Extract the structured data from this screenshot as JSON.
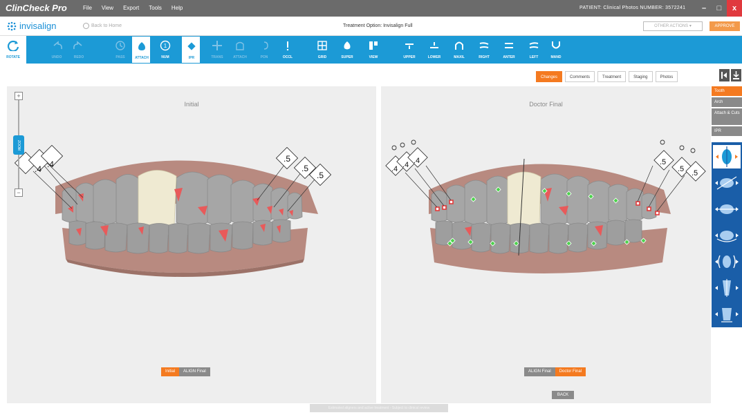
{
  "app": {
    "brand": "ClinCheck Pro",
    "menu": [
      "File",
      "View",
      "Export",
      "Tools",
      "Help"
    ],
    "patient_info": "PATIENT:  Clinical Photos  NUMBER:  3572241",
    "win_min": "–",
    "win_max": "□",
    "win_close": "x"
  },
  "header": {
    "logo": "invisalign",
    "back_home": "Back to Home",
    "treatment_option": "Treatment Option:  Invisalign Full",
    "other_actions": "OTHER ACTIONS ▾",
    "approve": "APPROVE"
  },
  "toolbar": {
    "tools": [
      {
        "id": "rotate",
        "label": "ROTATE",
        "state": "rotate"
      },
      {
        "id": "undo",
        "label": "UNDO",
        "state": "disabled"
      },
      {
        "id": "redo",
        "label": "REDO",
        "state": "disabled"
      },
      {
        "id": "pass",
        "label": "PASS",
        "state": "disabled"
      },
      {
        "id": "attach",
        "label": "ATTACH",
        "state": "active"
      },
      {
        "id": "num",
        "label": "NUM",
        "state": "normal"
      },
      {
        "id": "ipr",
        "label": "IPR",
        "state": "active"
      },
      {
        "id": "trans",
        "label": "TRANS",
        "state": "disabled"
      },
      {
        "id": "attach2",
        "label": "ATTACH",
        "state": "disabled"
      },
      {
        "id": "pon",
        "label": "PON",
        "state": "disabled"
      },
      {
        "id": "occl",
        "label": "OCCL",
        "state": "normal"
      },
      {
        "id": "grid",
        "label": "GRID",
        "state": "normal"
      },
      {
        "id": "super",
        "label": "SUPER",
        "state": "normal"
      },
      {
        "id": "view",
        "label": "VIEW",
        "state": "normal"
      },
      {
        "id": "upper",
        "label": "UPPER",
        "state": "normal"
      },
      {
        "id": "lower",
        "label": "LOWER",
        "state": "normal"
      },
      {
        "id": "maxil",
        "label": "MAXIL",
        "state": "normal"
      },
      {
        "id": "right",
        "label": "RIGHT",
        "state": "normal"
      },
      {
        "id": "anter",
        "label": "ANTER",
        "state": "normal"
      },
      {
        "id": "left",
        "label": "LEFT",
        "state": "normal"
      },
      {
        "id": "mand",
        "label": "MAND",
        "state": "normal"
      }
    ]
  },
  "tabs": [
    {
      "label": "Changes",
      "active": true
    },
    {
      "label": "Comments",
      "active": false
    },
    {
      "label": "Treatment",
      "active": false
    },
    {
      "label": "Staging",
      "active": false
    },
    {
      "label": "Photos",
      "active": false
    }
  ],
  "panels": {
    "left": {
      "title": "Initial",
      "ipr_labels": [
        ".4",
        ".4",
        ".5",
        ".5",
        ".5"
      ],
      "toggle": {
        "on": "Initial",
        "off": "ALIGN Final"
      }
    },
    "right": {
      "title": "Doctor Final",
      "ipr_labels": [
        ".4",
        ".4",
        ".4",
        ".5",
        ".5",
        ".5"
      ],
      "toggle": {
        "off": "ALIGN Final",
        "on": "Doctor Final"
      },
      "back": "BACK"
    }
  },
  "slider": {
    "plus": "+",
    "minus": "−",
    "thumb": "ZOOM"
  },
  "sidepanel": {
    "buttons": [
      {
        "label": "Tooth",
        "active": true
      },
      {
        "label": "Arch",
        "active": false
      },
      {
        "label": "Attach & Cuts",
        "active": false
      },
      {
        "label": "IPR",
        "active": false
      }
    ]
  },
  "footer_note": "Estimated aligners and active treatment - Subject to clinical review",
  "colors": {
    "toolbar": "#1c9ad6",
    "accent": "#f47a20",
    "gum": "#b88a80",
    "tooth": "#a6a6a6",
    "attachment": "#e85a5a",
    "highlight_tooth": "#efead2"
  }
}
